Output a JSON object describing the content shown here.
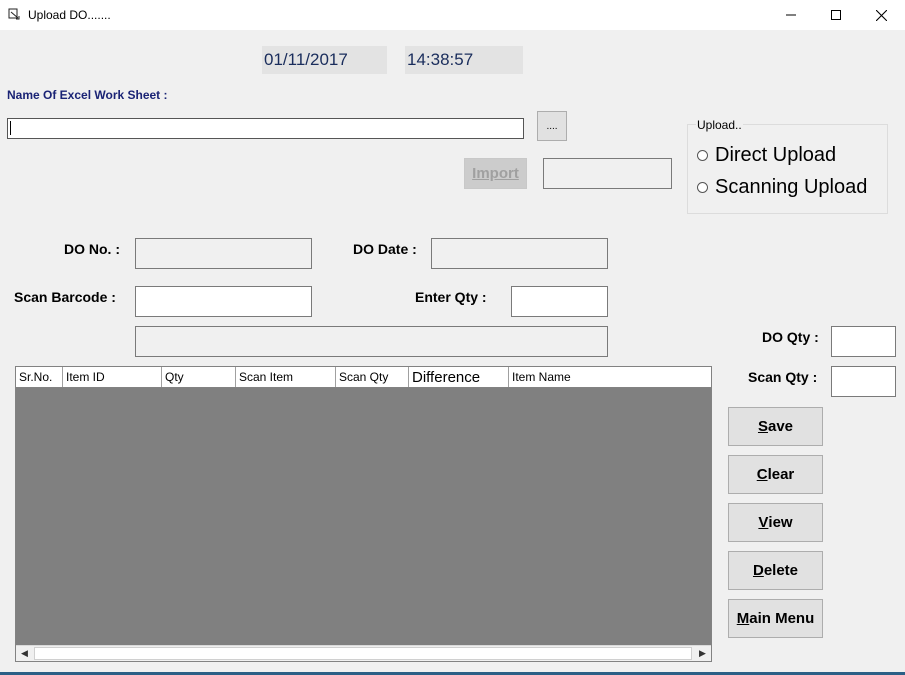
{
  "window": {
    "title": "Upload DO.......",
    "minimize_glyph": "—",
    "maximize_glyph": "☐",
    "close_glyph": "✕"
  },
  "header": {
    "date": "01/11/2017",
    "time": "14:38:57"
  },
  "excel": {
    "label": "Name Of Excel Work Sheet :",
    "path_value": "",
    "browse_label": "....",
    "import_label": "Import",
    "import_status": ""
  },
  "upload_group": {
    "title": "Upload..",
    "options": [
      "Direct Upload",
      "Scanning Upload"
    ]
  },
  "form": {
    "do_no_label": "DO No. :",
    "do_no_value": "",
    "do_date_label": "DO Date :",
    "do_date_value": "",
    "scan_barcode_label": "Scan Barcode :",
    "scan_barcode_value": "",
    "enter_qty_label": "Enter Qty :",
    "enter_qty_value": "",
    "info_value": "",
    "do_qty_label": "DO Qty :",
    "do_qty_value": "",
    "scan_qty_label": "Scan Qty :",
    "scan_qty_value": ""
  },
  "grid": {
    "columns": [
      "Sr.No.",
      "Item ID",
      "Qty",
      "Scan Item",
      "Scan Qty",
      "Difference",
      "Item Name"
    ],
    "rows": []
  },
  "buttons": {
    "save": {
      "hotkey": "S",
      "rest": "ave"
    },
    "clear": {
      "hotkey": "C",
      "rest": "lear"
    },
    "view": {
      "hotkey": "V",
      "rest": "iew"
    },
    "delete": {
      "hotkey": "D",
      "rest": "elete"
    },
    "main_menu": {
      "hotkey": "M",
      "rest": "ain Menu"
    }
  },
  "icons": {
    "app": "form-icon",
    "scroll_left": "scroll-left-icon",
    "scroll_right": "scroll-right-icon"
  }
}
